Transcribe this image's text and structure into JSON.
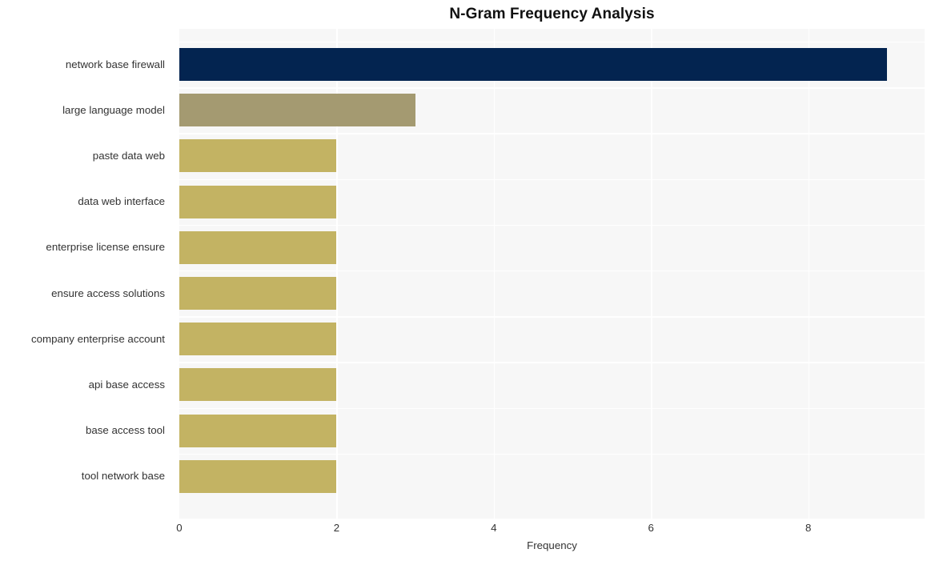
{
  "chart_data": {
    "type": "bar",
    "orientation": "horizontal",
    "title": "N-Gram Frequency Analysis",
    "xlabel": "Frequency",
    "ylabel": "",
    "categories": [
      "network base firewall",
      "large language model",
      "paste data web",
      "data web interface",
      "enterprise license ensure",
      "ensure access solutions",
      "company enterprise account",
      "api base access",
      "base access tool",
      "tool network base"
    ],
    "values": [
      9,
      3,
      2,
      2,
      2,
      2,
      2,
      2,
      2,
      2
    ],
    "bar_colors": [
      "#032450",
      "#a49a71",
      "#c3b363",
      "#c3b363",
      "#c3b363",
      "#c3b363",
      "#c3b363",
      "#c3b363",
      "#c3b363",
      "#c3b363"
    ],
    "xlim": [
      0,
      9.48
    ],
    "xticks": [
      0,
      2,
      4,
      6,
      8
    ],
    "xtick_labels": [
      "0",
      "2",
      "4",
      "6",
      "8"
    ],
    "grid": true,
    "grid_color": "#ffffff",
    "plot_background": "#f7f7f7",
    "figure_background": "#ffffff",
    "legend": null
  }
}
